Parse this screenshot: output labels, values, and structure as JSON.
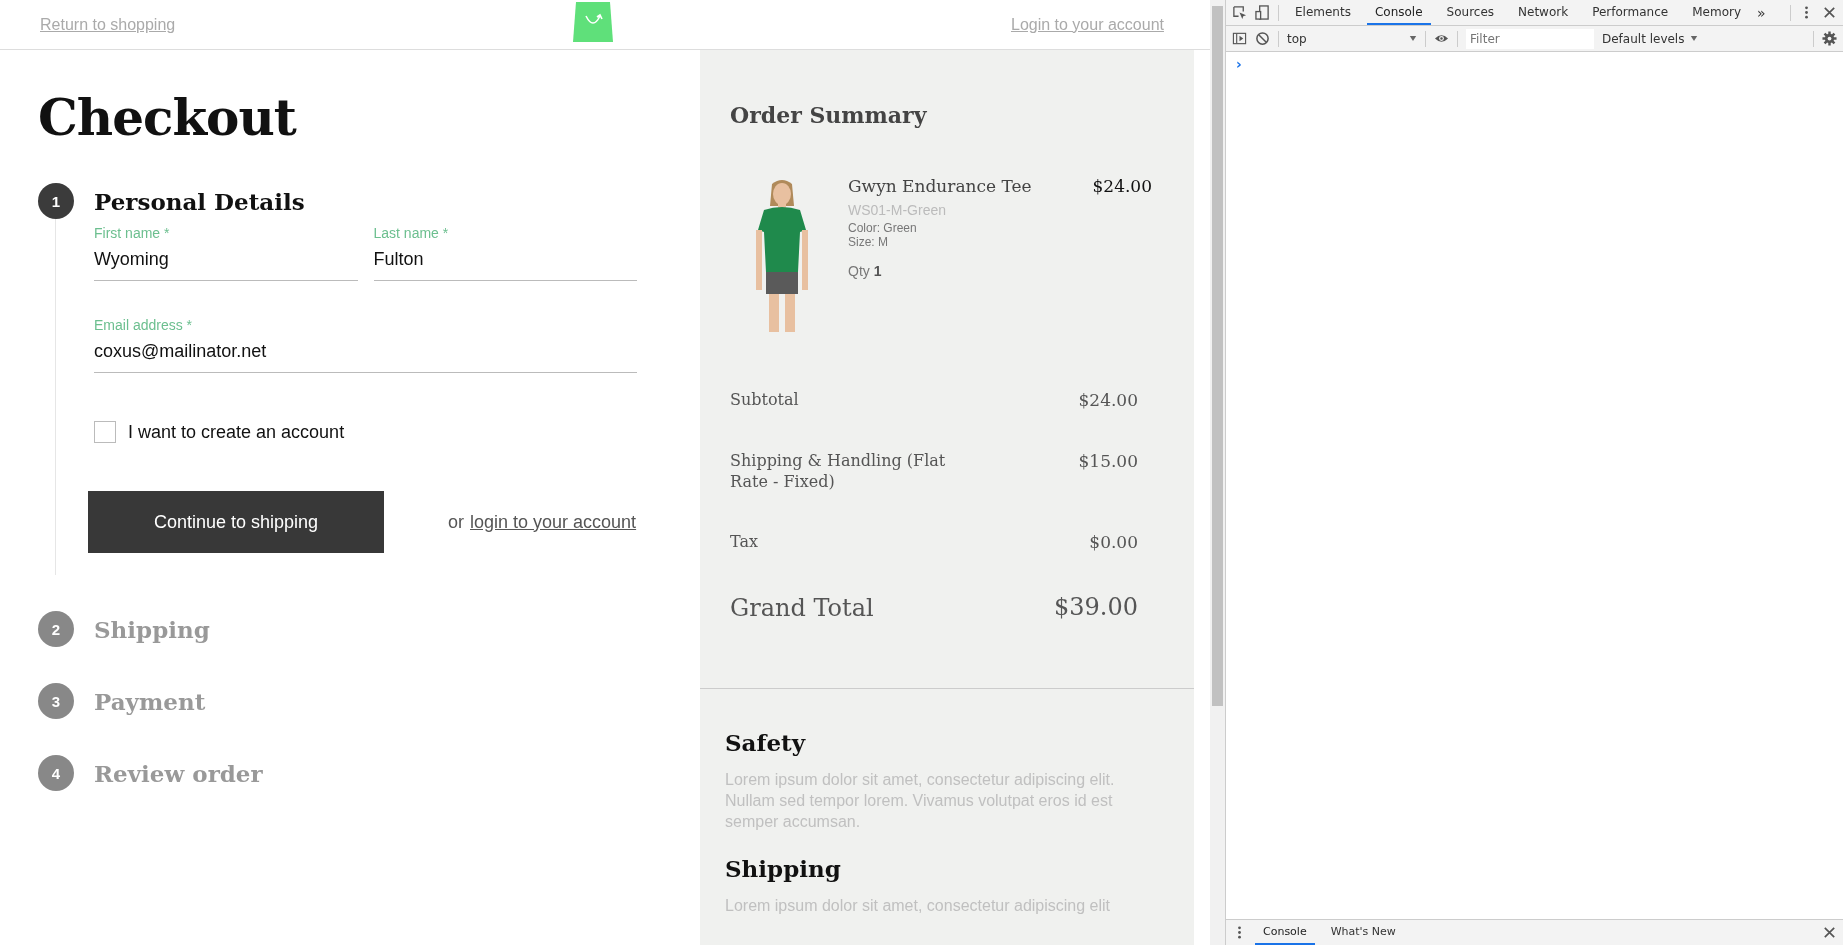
{
  "header": {
    "return_link": "Return to shopping",
    "login_link": "Login to your account"
  },
  "checkout": {
    "title": "Checkout",
    "steps": [
      {
        "number": "1",
        "title": "Personal Details",
        "active": true
      },
      {
        "number": "2",
        "title": "Shipping",
        "active": false
      },
      {
        "number": "3",
        "title": "Payment",
        "active": false
      },
      {
        "number": "4",
        "title": "Review order",
        "active": false
      }
    ],
    "fields": [
      {
        "label": "First name *",
        "value": "Wyoming"
      },
      {
        "label": "Last name *",
        "value": "Fulton"
      },
      {
        "label": "Email address *",
        "value": "coxus@mailinator.net"
      }
    ],
    "create_account": {
      "label": "I want to create an account",
      "checked": false
    },
    "continue_button": "Continue to shipping",
    "or_text": "or",
    "login_link": "login to your account"
  },
  "summary": {
    "title": "Order Summary",
    "items": [
      {
        "name": "Gwyn Endurance Tee",
        "sku": "WS01-M-Green",
        "color_option": "Color: Green",
        "size": "Size: M",
        "qty_label": "Qty",
        "qty": "1",
        "price": "$24.00"
      }
    ],
    "totals": [
      {
        "kind": "line",
        "label": "Subtotal",
        "amount": "$24.00"
      },
      {
        "kind": "line",
        "label": "Shipping & Handling (Flat Rate - Fixed)",
        "amount": "$15.00"
      },
      {
        "kind": "line",
        "label": "Tax",
        "amount": "$0.00"
      },
      {
        "kind": "grand",
        "label": "Grand Total",
        "amount": "$39.00"
      }
    ]
  },
  "info_sections": [
    {
      "title": "Safety",
      "text": "Lorem ipsum dolor sit amet, consectetur adipiscing elit. Nullam sed tempor lorem. Vivamus volutpat eros id est semper accumsan."
    },
    {
      "title": "Shipping",
      "text": "Lorem ipsum dolor sit amet, consectetur adipiscing elit"
    }
  ],
  "devtools": {
    "tabs": [
      {
        "label": "Elements",
        "selected": false
      },
      {
        "label": "Console",
        "selected": true
      },
      {
        "label": "Sources",
        "selected": false
      },
      {
        "label": "Network",
        "selected": false
      },
      {
        "label": "Performance",
        "selected": false
      },
      {
        "label": "Memory",
        "selected": false
      }
    ],
    "more": "»",
    "context": "top",
    "filter_placeholder": "Filter",
    "levels": "Default levels",
    "prompt": "›",
    "drawer_tabs": [
      {
        "label": "Console",
        "selected": true
      },
      {
        "label": "What's New",
        "selected": false
      }
    ]
  }
}
